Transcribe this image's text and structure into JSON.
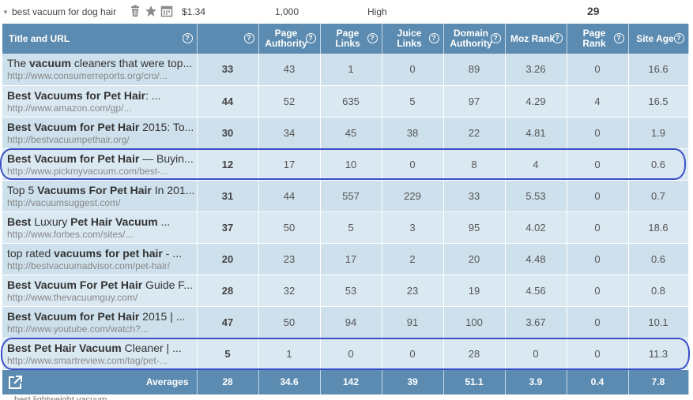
{
  "keyword": {
    "text": "best vacuum for dog hair",
    "cpc": "$1.34",
    "volume": "1,000",
    "competition": "High",
    "difficulty": "29",
    "icons": [
      "trash-icon",
      "star-icon",
      "calendar-icon"
    ]
  },
  "columns": [
    {
      "label": "Title and URL",
      "help": "?"
    },
    {
      "label": "",
      "help": "?"
    },
    {
      "label": "Page Authority",
      "help": "?"
    },
    {
      "label": "Page Links",
      "help": "?"
    },
    {
      "label": "Juice Links",
      "help": "?"
    },
    {
      "label": "Domain Authority",
      "help": "?"
    },
    {
      "label": "Moz Rank",
      "help": "?"
    },
    {
      "label": "Page Rank",
      "help": "?"
    },
    {
      "label": "Site Age",
      "help": "?"
    }
  ],
  "rows": [
    {
      "title_parts": [
        [
          "The ",
          false
        ],
        [
          "vacuum",
          true
        ],
        [
          " cleaners that were top...",
          false
        ]
      ],
      "url": "http://www.consumerreports.org/cro/...",
      "score": "33",
      "pa": "43",
      "pl": "1",
      "jl": "0",
      "da": "89",
      "mr": "3.26",
      "pr": "0",
      "age": "16.6"
    },
    {
      "title_parts": [
        [
          "Best Vacuums for Pet Hair",
          true
        ],
        [
          ": ...",
          false
        ]
      ],
      "url": "http://www.amazon.com/gp/...",
      "score": "44",
      "pa": "52",
      "pl": "635",
      "jl": "5",
      "da": "97",
      "mr": "4.29",
      "pr": "4",
      "age": "16.5"
    },
    {
      "title_parts": [
        [
          "Best Vacuum for Pet Hair",
          true
        ],
        [
          " 2015: To...",
          false
        ]
      ],
      "url": "http://bestvacuumpethair.org/",
      "score": "30",
      "pa": "34",
      "pl": "45",
      "jl": "38",
      "da": "22",
      "mr": "4.81",
      "pr": "0",
      "age": "1.9"
    },
    {
      "title_parts": [
        [
          "Best Vacuum for Pet Hair",
          true
        ],
        [
          " — Buyin...",
          false
        ]
      ],
      "url": "http://www.pickmyvacuum.com/best-...",
      "score": "12",
      "pa": "17",
      "pl": "10",
      "jl": "0",
      "da": "8",
      "mr": "4",
      "pr": "0",
      "age": "0.6"
    },
    {
      "title_parts": [
        [
          "Top 5 ",
          false
        ],
        [
          "Vacuums For Pet Hair",
          true
        ],
        [
          " In 201...",
          false
        ]
      ],
      "url": "http://vacuumsuggest.com/",
      "score": "31",
      "pa": "44",
      "pl": "557",
      "jl": "229",
      "da": "33",
      "mr": "5.53",
      "pr": "0",
      "age": "0.7"
    },
    {
      "title_parts": [
        [
          "Best",
          true
        ],
        [
          " Luxury ",
          false
        ],
        [
          "Pet Hair Vacuum",
          true
        ],
        [
          " ...",
          false
        ]
      ],
      "url": "http://www.forbes.com/sites/...",
      "score": "37",
      "pa": "50",
      "pl": "5",
      "jl": "3",
      "da": "95",
      "mr": "4.02",
      "pr": "0",
      "age": "18.6"
    },
    {
      "title_parts": [
        [
          "top rated ",
          false
        ],
        [
          "vacuums for pet hair",
          true
        ],
        [
          " - ...",
          false
        ]
      ],
      "url": "http://bestvacuumadvisor.com/pet-hair/",
      "score": "20",
      "pa": "23",
      "pl": "17",
      "jl": "2",
      "da": "20",
      "mr": "4.48",
      "pr": "0",
      "age": "0.6"
    },
    {
      "title_parts": [
        [
          "Best Vacuum For Pet Hair",
          true
        ],
        [
          " Guide F...",
          false
        ]
      ],
      "url": "http://www.thevacuumguy.com/",
      "score": "28",
      "pa": "32",
      "pl": "53",
      "jl": "23",
      "da": "19",
      "mr": "4.56",
      "pr": "0",
      "age": "0.8"
    },
    {
      "title_parts": [
        [
          "Best Vacuum for Pet Hair",
          true
        ],
        [
          " 2015 | ...",
          false
        ]
      ],
      "url": "http://www.youtube.com/watch?...",
      "score": "47",
      "pa": "50",
      "pl": "94",
      "jl": "91",
      "da": "100",
      "mr": "3.67",
      "pr": "0",
      "age": "10.1"
    },
    {
      "title_parts": [
        [
          "Best Pet Hair Vacuum",
          true
        ],
        [
          " Cleaner | ...",
          false
        ]
      ],
      "url": "http://www.smartreview.com/tag/pet-...",
      "score": "5",
      "pa": "1",
      "pl": "0",
      "jl": "0",
      "da": "28",
      "mr": "0",
      "pr": "0",
      "age": "11.3"
    }
  ],
  "averages": {
    "label": "Averages",
    "score": "28",
    "pa": "34.6",
    "pl": "142",
    "jl": "39",
    "da": "51.1",
    "mr": "3.9",
    "pr": "0.4",
    "age": "7.8"
  },
  "next_keyword": "best lightweight vacuum",
  "colors": {
    "header": "#5b8bb0",
    "row_a": "#cde0ec",
    "row_b": "#d9e8f1",
    "highlight": "#3b4fc8"
  }
}
